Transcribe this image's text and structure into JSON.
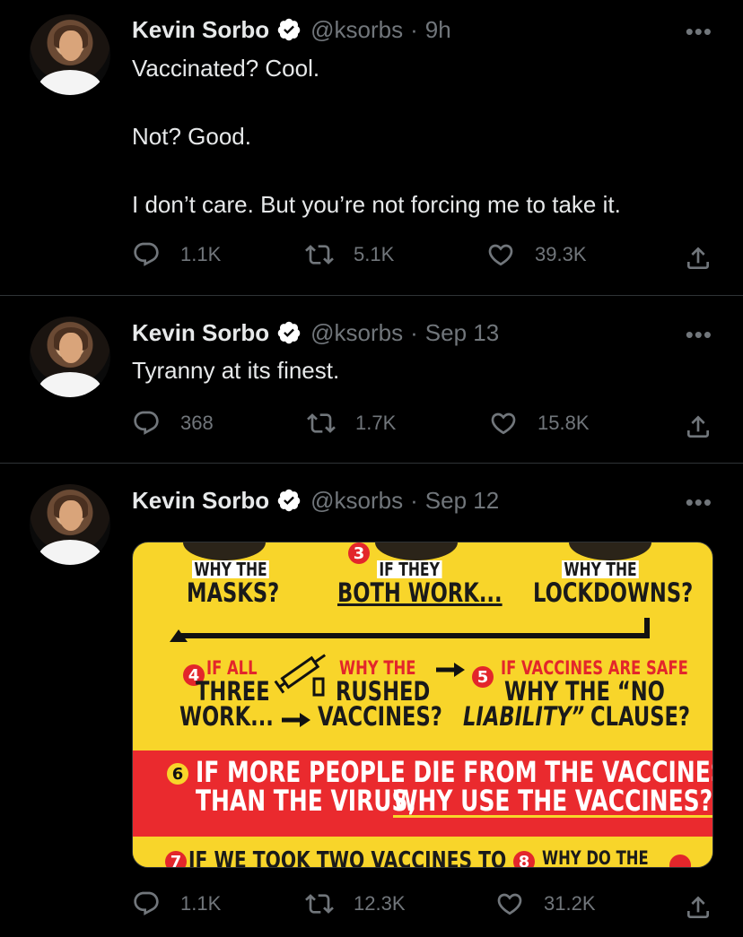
{
  "colors": {
    "background": "#000000",
    "text": "#e7e9ea",
    "muted": "#71767b",
    "divider": "#2f3336",
    "verified": "#ffffff"
  },
  "icons": {
    "reply": "reply-icon",
    "retweet": "retweet-icon",
    "like": "heart-icon",
    "share": "share-icon",
    "more": "more-icon",
    "verified": "verified-badge-icon"
  },
  "tweets": [
    {
      "name": "Kevin Sorbo",
      "handle": "@ksorbs",
      "separator": "·",
      "time": "9h",
      "more": "•••",
      "text": "Vaccinated? Cool.\n\nNot? Good.\n\nI don’t care. But you’re not forcing me to take it.",
      "replies": "1.1K",
      "retweets": "5.1K",
      "likes": "39.3K"
    },
    {
      "name": "Kevin Sorbo",
      "handle": "@ksorbs",
      "separator": "·",
      "time": "Sep 13",
      "more": "•••",
      "text": "Tyranny at its finest.",
      "replies": "368",
      "retweets": "1.7K",
      "likes": "15.8K"
    },
    {
      "name": "Kevin Sorbo",
      "handle": "@ksorbs",
      "separator": "·",
      "time": "Sep 12",
      "more": "•••",
      "replies": "1.1K",
      "retweets": "12.3K",
      "likes": "31.2K",
      "media": {
        "why_the_1": "WHY THE",
        "masks": "MASKS?",
        "num3": "3",
        "if_they": "IF THEY",
        "both_work": "BOTH WORK...",
        "why_the_2": "WHY THE",
        "lockdowns": "LOCKDOWNS?",
        "num4": "4",
        "if_all": "IF ALL",
        "three": "THREE",
        "work": "WORK...",
        "why_the_3": "WHY THE",
        "rushed": "RUSHED",
        "vaccines_q": "VACCINES?",
        "num5": "5",
        "if_vaccines_safe": "IF VACCINES ARE SAFE",
        "why_the_no": "WHY THE “NO",
        "liability": "LIABILITY”",
        "clause": "CLAUSE?",
        "num6": "6",
        "line6a": "IF MORE PEOPLE DIE FROM THE VACCINES",
        "line6b_1": "THAN THE VIRUS,",
        "line6b_2": "WHY USE THE VACCINES?",
        "num7": "7",
        "line7": "IF WE TOOK TWO VACCINES TO",
        "num8": "8",
        "line8": "WHY DO THE"
      }
    }
  ]
}
